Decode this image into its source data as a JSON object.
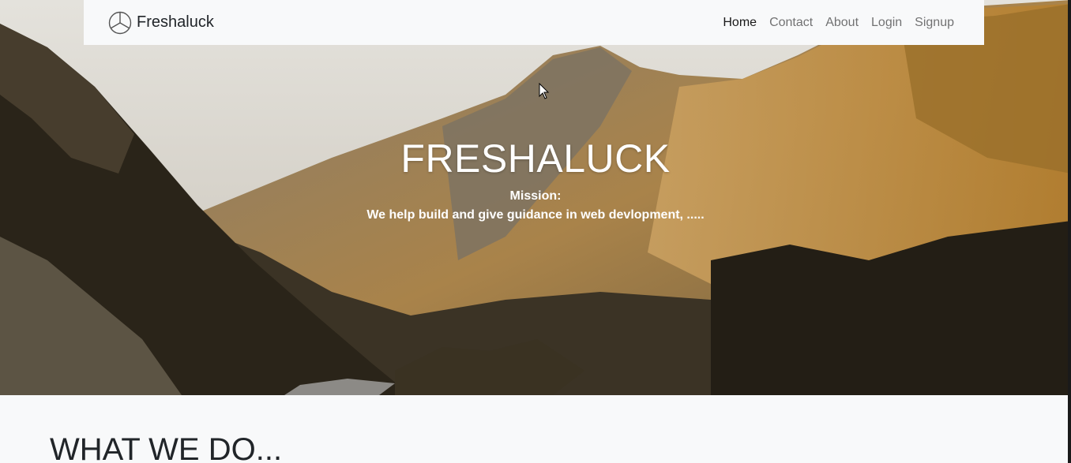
{
  "navbar": {
    "brand": "Freshaluck",
    "brand_icon": "mercedes-star-icon",
    "links": [
      {
        "label": "Home",
        "active": true
      },
      {
        "label": "Contact",
        "active": false
      },
      {
        "label": "About",
        "active": false
      },
      {
        "label": "Login",
        "active": false
      },
      {
        "label": "Signup",
        "active": false
      }
    ]
  },
  "hero": {
    "title": "FRESHALUCK",
    "mission_label": "Mission:",
    "mission_text": "We help build and give guidance in web devlopment, ....."
  },
  "section": {
    "title": "WHAT WE DO..."
  }
}
